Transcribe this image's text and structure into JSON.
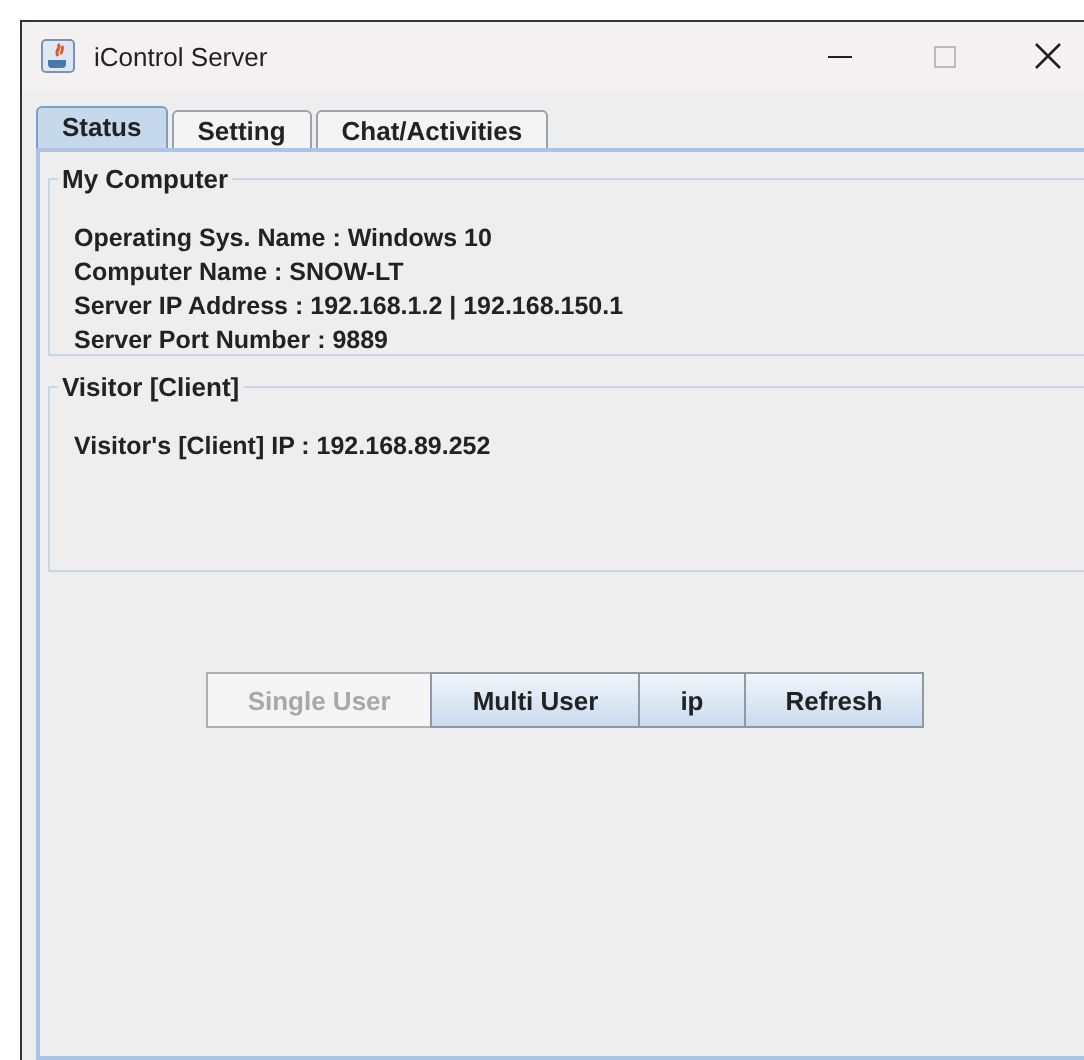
{
  "window": {
    "title": "iControl Server"
  },
  "tabs": [
    {
      "label": "Status",
      "selected": true
    },
    {
      "label": "Setting",
      "selected": false
    },
    {
      "label": "Chat/Activities",
      "selected": false
    }
  ],
  "groups": [
    {
      "title": "My Computer",
      "lines": [
        "Operating Sys. Name : Windows 10",
        "Computer Name : SNOW-LT",
        "Server IP Address : 192.168.1.2 | 192.168.150.1",
        "Server Port Number : 9889"
      ]
    },
    {
      "title": "Visitor [Client]",
      "lines": [
        "Visitor's [Client] IP : 192.168.89.252"
      ]
    }
  ],
  "buttons": [
    {
      "label": "Single User",
      "disabled": true
    },
    {
      "label": "Multi User",
      "disabled": false
    },
    {
      "label": "ip",
      "disabled": false
    },
    {
      "label": "Refresh",
      "disabled": false
    }
  ]
}
